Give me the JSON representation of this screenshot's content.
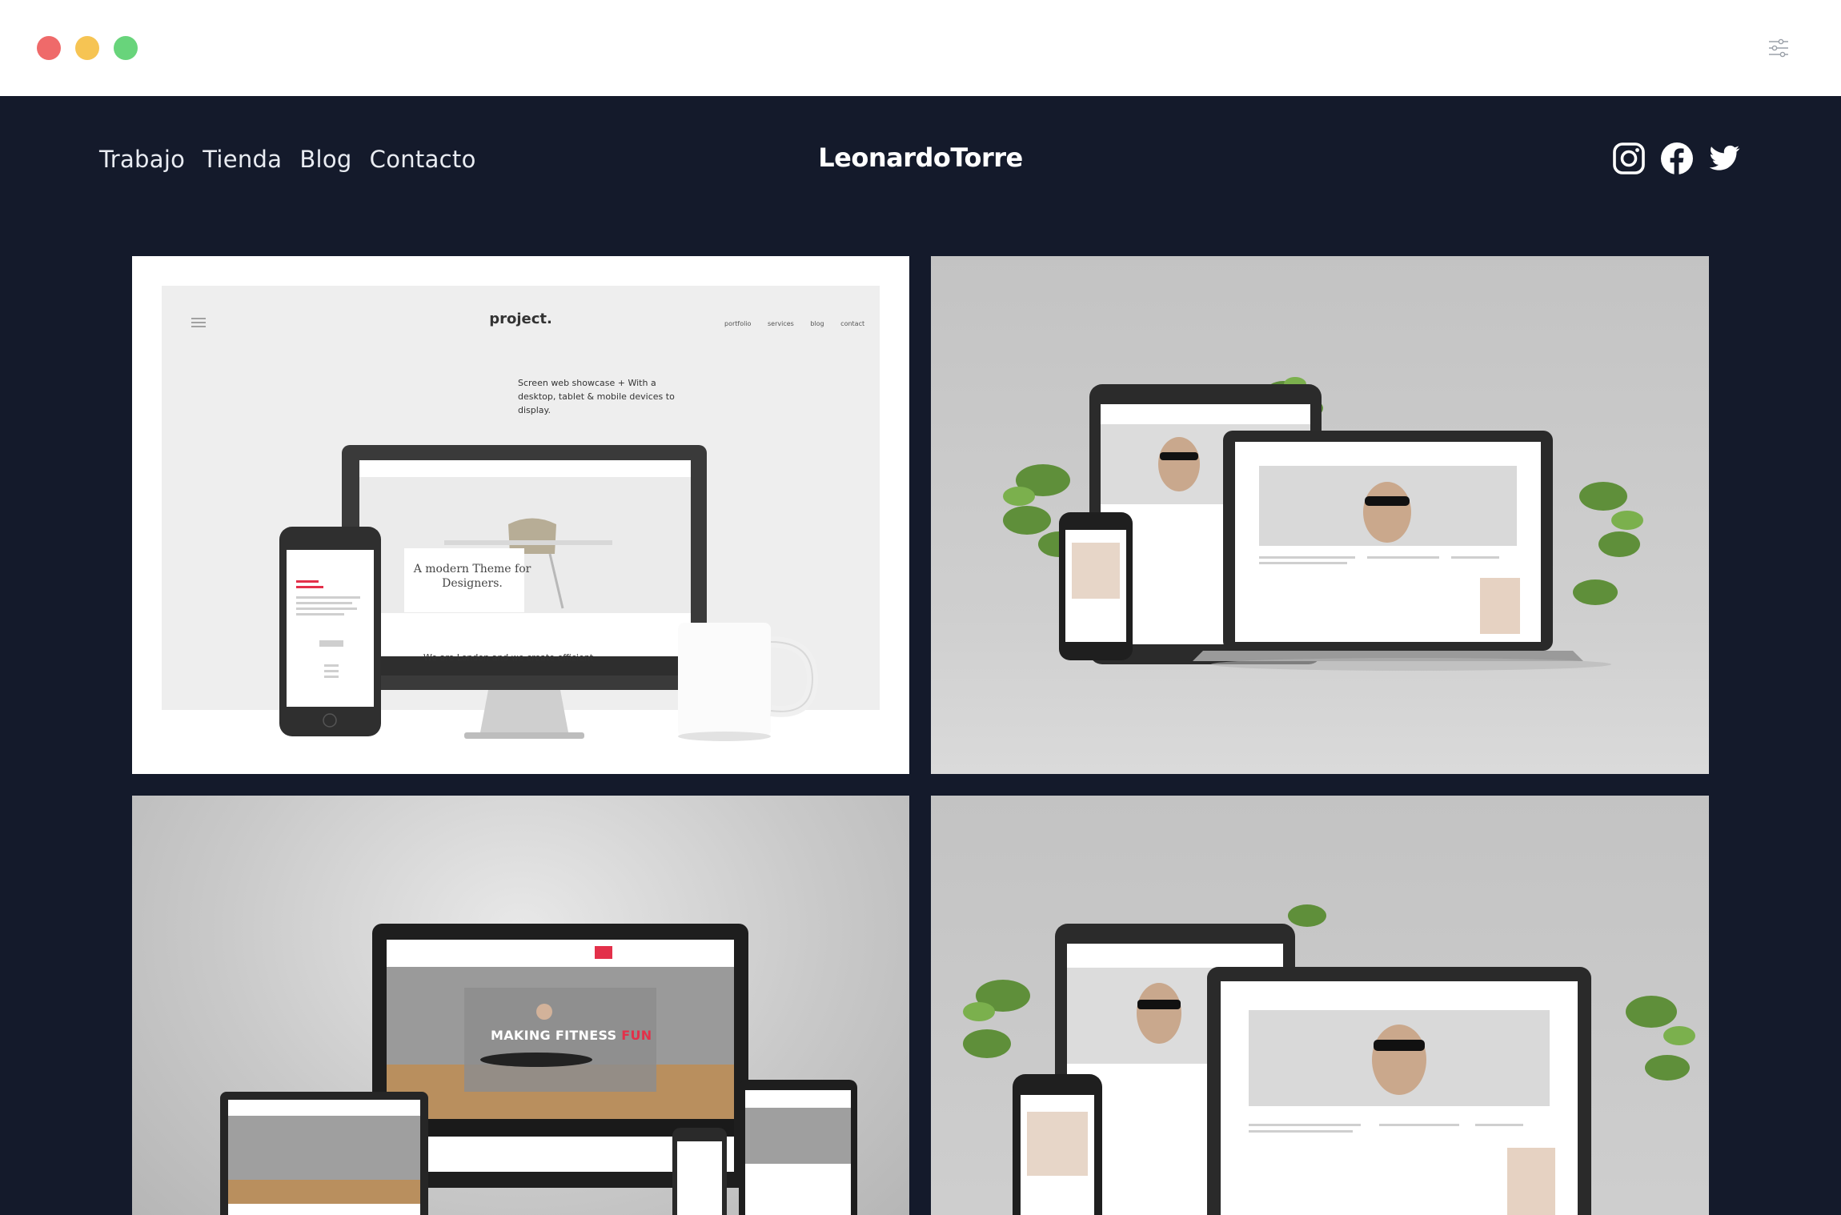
{
  "window": {
    "controls": [
      "close",
      "minimize",
      "maximize"
    ],
    "settings_icon": "sliders-icon"
  },
  "site": {
    "brand": "LeonardoTorre",
    "nav": [
      "Trabajo",
      "Tienda",
      "Blog",
      "Contacto"
    ],
    "social": [
      "instagram-icon",
      "facebook-icon",
      "twitter-icon"
    ],
    "colors": {
      "background": "#141a2b",
      "text": "#e9ecf2",
      "accent": "#e3304a"
    }
  },
  "portfolio": {
    "tile1": {
      "logo": "project.",
      "mini_nav": "portfolio services blog contact",
      "hero_text": "Screen web showcase + With a desktop, tablet & mobile devices to display.",
      "card_text": "A modern Theme for Designers.",
      "caption": "We are London and we create efficient"
    },
    "tile3": {
      "title_main": "MAKING FITNESS ",
      "title_accent": "FUN"
    }
  }
}
